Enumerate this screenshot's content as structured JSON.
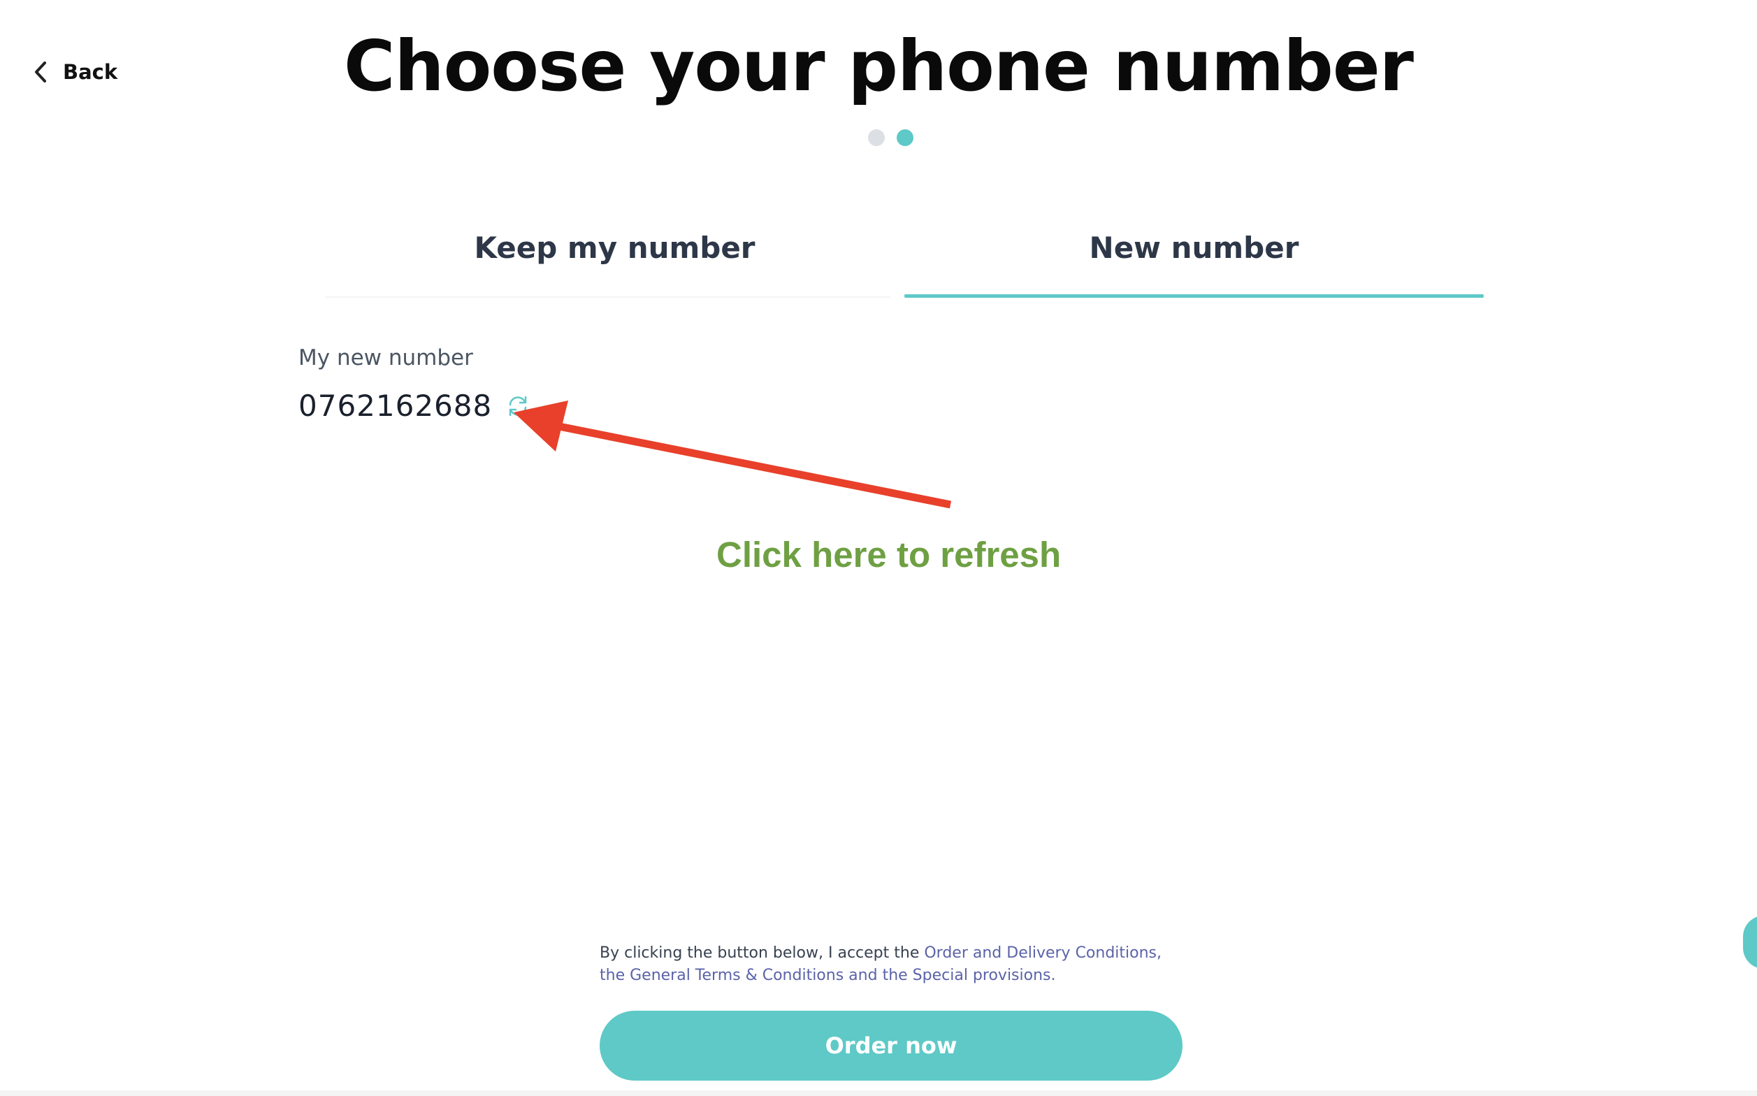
{
  "nav": {
    "back_label": "Back"
  },
  "page": {
    "title": "Choose your phone number"
  },
  "stepper": {
    "steps_total": 2,
    "current_step": 2,
    "inactive_color": "#dcdfe3",
    "active_color": "#5ec9c7"
  },
  "tabs": [
    {
      "label": "Keep my number",
      "active": false
    },
    {
      "label": "New number",
      "active": true
    }
  ],
  "new_number": {
    "label": "My new number",
    "value": "0762162688",
    "refresh_icon": "refresh-icon"
  },
  "annotation": {
    "text": "Click here to refresh",
    "arrow_color": "#e8402a",
    "text_color": "#6ea043"
  },
  "terms": {
    "prefix": "By clicking the button below, I accept the ",
    "link_1": "Order and Delivery Conditions",
    "sep_1": ", the ",
    "link_2": "General Terms & Conditions",
    "sep_2": " and the ",
    "link_3": "Special provisions",
    "suffix": "."
  },
  "actions": {
    "order_label": "Order now"
  },
  "colors": {
    "accent": "#5ec9c7",
    "link": "#5b63a8"
  }
}
